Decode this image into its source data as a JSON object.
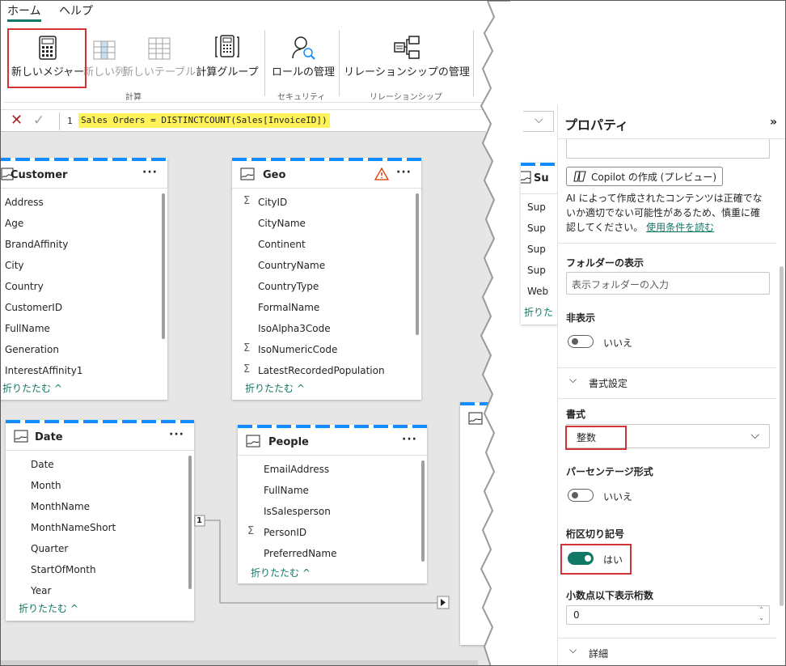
{
  "ribbon": {
    "tabs": [
      {
        "label": "ホーム",
        "active": true
      },
      {
        "label": "ヘルプ",
        "active": false
      }
    ],
    "buttons": {
      "new_measure": "新しいメジャー",
      "new_column": "新しい列",
      "new_table": "新しいテーブル",
      "calc_group": "計算グループ",
      "manage_roles": "ロールの管理",
      "manage_relationships": "リレーションシップの管理"
    },
    "groups": {
      "calc": "計算",
      "security": "セキュリティ",
      "relationships": "リレーションシップ"
    }
  },
  "formula_bar": {
    "line_number": "1",
    "formula": "Sales Orders = DISTINCTCOUNT(Sales[InvoiceID])"
  },
  "canvas": {
    "collapse_label": "折りたたむ ^",
    "relationship_label": "1",
    "tables": {
      "customer": {
        "title": "Customer",
        "fields": [
          "Address",
          "Age",
          "BrandAffinity",
          "City",
          "Country",
          "CustomerID",
          "FullName",
          "Generation",
          "InterestAffinity1"
        ]
      },
      "geo": {
        "title": "Geo",
        "fields": [
          "CityID",
          "CityName",
          "Continent",
          "CountryName",
          "CountryType",
          "FormalName",
          "IsoAlpha3Code",
          "IsoNumericCode",
          "LatestRecordedPopulation"
        ]
      },
      "date": {
        "title": "Date",
        "fields": [
          "Date",
          "Month",
          "MonthName",
          "MonthNameShort",
          "Quarter",
          "StartOfMonth",
          "Year"
        ]
      },
      "people": {
        "title": "People",
        "fields": [
          "EmailAddress",
          "FullName",
          "IsSalesperson",
          "PersonID",
          "PreferredName"
        ]
      },
      "supplier_partial": {
        "title": "Su",
        "fields": [
          "Sup",
          "Sup",
          "Sup",
          "Sup",
          "Web"
        ],
        "collapse": "折りた"
      }
    }
  },
  "properties": {
    "title": "プロパティ",
    "copilot_button": "Copilot の作成 (プレビュー)",
    "ai_disclaimer": [
      "AI によって作成されたコンテンツは正確でな",
      "いか適切でない可能性があるため、慎重に確",
      "認してください。"
    ],
    "terms_link": "使用条件を読む",
    "display_folder_label": "フォルダーの表示",
    "display_folder_placeholder": "表示フォルダーの入力",
    "hidden_label": "非表示",
    "hidden_value": "いいえ",
    "formatting_section": "書式設定",
    "format_label": "書式",
    "format_value": "整数",
    "percent_label": "パーセンテージ形式",
    "percent_value": "いいえ",
    "thousands_label": "桁区切り記号",
    "thousands_value": "はい",
    "decimals_label": "小数点以下表示桁数",
    "decimals_value": "0",
    "details_section": "詳細"
  },
  "colors": {
    "accent": "#117865",
    "highlight": "#fff35c",
    "annotation": "#d13438",
    "header_stripe": "#118dff"
  }
}
